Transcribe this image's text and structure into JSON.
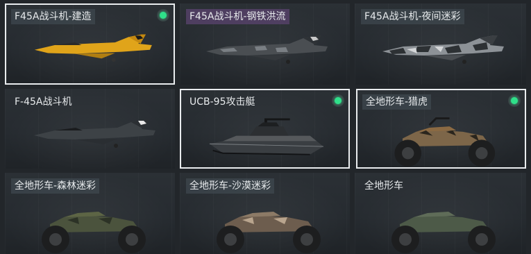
{
  "grid": {
    "items": [
      {
        "label": "F45A战斗机-建造",
        "selected": true,
        "equipped": true,
        "icon": "jet-icon",
        "skin": "yellow"
      },
      {
        "label": "F45A战斗机-钢铁洪流",
        "selected": false,
        "equipped": false,
        "icon": "jet-icon",
        "skin": "steel-camo"
      },
      {
        "label": "F45A战斗机-夜间迷彩",
        "selected": false,
        "equipped": false,
        "icon": "jet-icon",
        "skin": "night-camo"
      },
      {
        "label": "F-45A战斗机",
        "selected": false,
        "equipped": false,
        "icon": "jet-icon",
        "skin": "default"
      },
      {
        "label": "UCB-95攻击艇",
        "selected": true,
        "equipped": true,
        "icon": "boat-icon",
        "skin": "default"
      },
      {
        "label": "全地形车-猎虎",
        "selected": true,
        "equipped": true,
        "icon": "atv-icon",
        "skin": "tiger"
      },
      {
        "label": "全地形车-森林迷彩",
        "selected": false,
        "equipped": false,
        "icon": "atv-icon",
        "skin": "forest-camo"
      },
      {
        "label": "全地形车-沙漠迷彩",
        "selected": false,
        "equipped": false,
        "icon": "atv-icon",
        "skin": "desert-camo"
      },
      {
        "label": "全地形车",
        "selected": false,
        "equipped": false,
        "icon": "atv-icon",
        "skin": "default"
      }
    ]
  },
  "colors": {
    "equipped_indicator": "#2fe08a",
    "selected_border": "#e9ecee",
    "label_highlight": "#58426c"
  }
}
